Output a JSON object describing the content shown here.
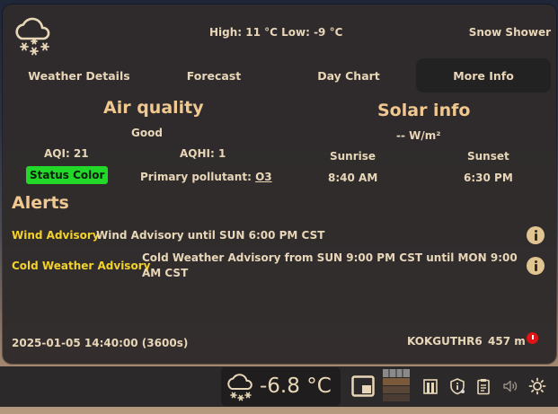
{
  "header": {
    "icon": "snow-shower-icon",
    "high_low": "High: 11 °C Low: -9 °C",
    "condition": "Snow Shower"
  },
  "tabs": [
    {
      "label": "Weather Details",
      "active": false
    },
    {
      "label": "Forecast",
      "active": false
    },
    {
      "label": "Day Chart",
      "active": false
    },
    {
      "label": "More Info",
      "active": true
    }
  ],
  "air_quality": {
    "title": "Air quality",
    "rating": "Good",
    "aqi": "AQI: 21",
    "aqhi": "AQHI: 1",
    "status_label": "Status Color",
    "status_color": "#22d828",
    "pollutant_label": "Primary pollutant:",
    "pollutant_value": "O3"
  },
  "solar": {
    "title": "Solar info",
    "irradiance": "-- W/m²",
    "sunrise_label": "Sunrise",
    "sunset_label": "Sunset",
    "sunrise": "8:40 AM",
    "sunset": "6:30 PM"
  },
  "alerts": {
    "title": "Alerts",
    "items": [
      {
        "name": "Wind Advisory",
        "description": "Wind Advisory until SUN 6:00 PM CST"
      },
      {
        "name": "Cold Weather Advisory",
        "description": "Cold Weather Advisory from SUN 9:00 PM CST until MON 9:00 AM CST"
      }
    ]
  },
  "footer": {
    "timestamp": "2025-01-05 14:40:00 (3600s)",
    "station": "KOKGUTHR6",
    "elevation": "457 m"
  },
  "panel": {
    "temperature": "-6.8 °C",
    "tray_icons": [
      "window-icon",
      "pager-icon",
      "bookmark-icon",
      "shield-info-icon",
      "clipboard-icon",
      "volume-icon",
      "brightness-icon"
    ]
  },
  "colors": {
    "accent": "#f0c890",
    "text": "#e8d6b8",
    "alert_name": "#f3d22a",
    "error": "#e01414"
  }
}
